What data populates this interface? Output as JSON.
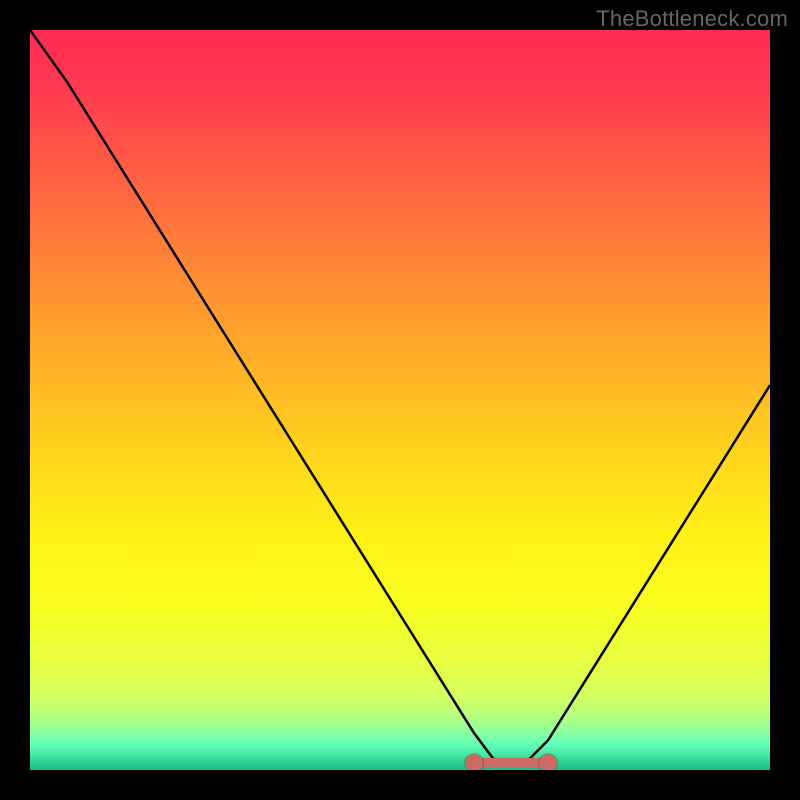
{
  "watermark": "TheBottleneck.com",
  "colors": {
    "background": "#000000",
    "curve": "#000000",
    "marker": "#cc6b63"
  },
  "chart_data": {
    "type": "line",
    "title": "",
    "xlabel": "",
    "ylabel": "",
    "xlim": [
      0,
      100
    ],
    "ylim": [
      0,
      100
    ],
    "grid": false,
    "legend": false,
    "series": [
      {
        "name": "bottleneck-curve",
        "x": [
          0,
          5,
          10,
          15,
          20,
          25,
          30,
          35,
          40,
          45,
          50,
          55,
          60,
          63,
          67,
          70,
          75,
          80,
          85,
          90,
          95,
          100
        ],
        "y": [
          100,
          93,
          85,
          77,
          69,
          61,
          53,
          45,
          37,
          29,
          21,
          13,
          5,
          1,
          1,
          4,
          12,
          20,
          28,
          36,
          44,
          52
        ]
      }
    ],
    "annotations": [
      {
        "name": "trough-segment",
        "x_range": [
          60,
          70
        ],
        "y": 1
      }
    ],
    "background_gradient": {
      "direction": "vertical",
      "stops": [
        {
          "pos": 0,
          "color": "#ff2a55"
        },
        {
          "pos": 50,
          "color": "#ffd61c"
        },
        {
          "pos": 85,
          "color": "#e8ff40"
        },
        {
          "pos": 100,
          "color": "#18c080"
        }
      ]
    }
  }
}
